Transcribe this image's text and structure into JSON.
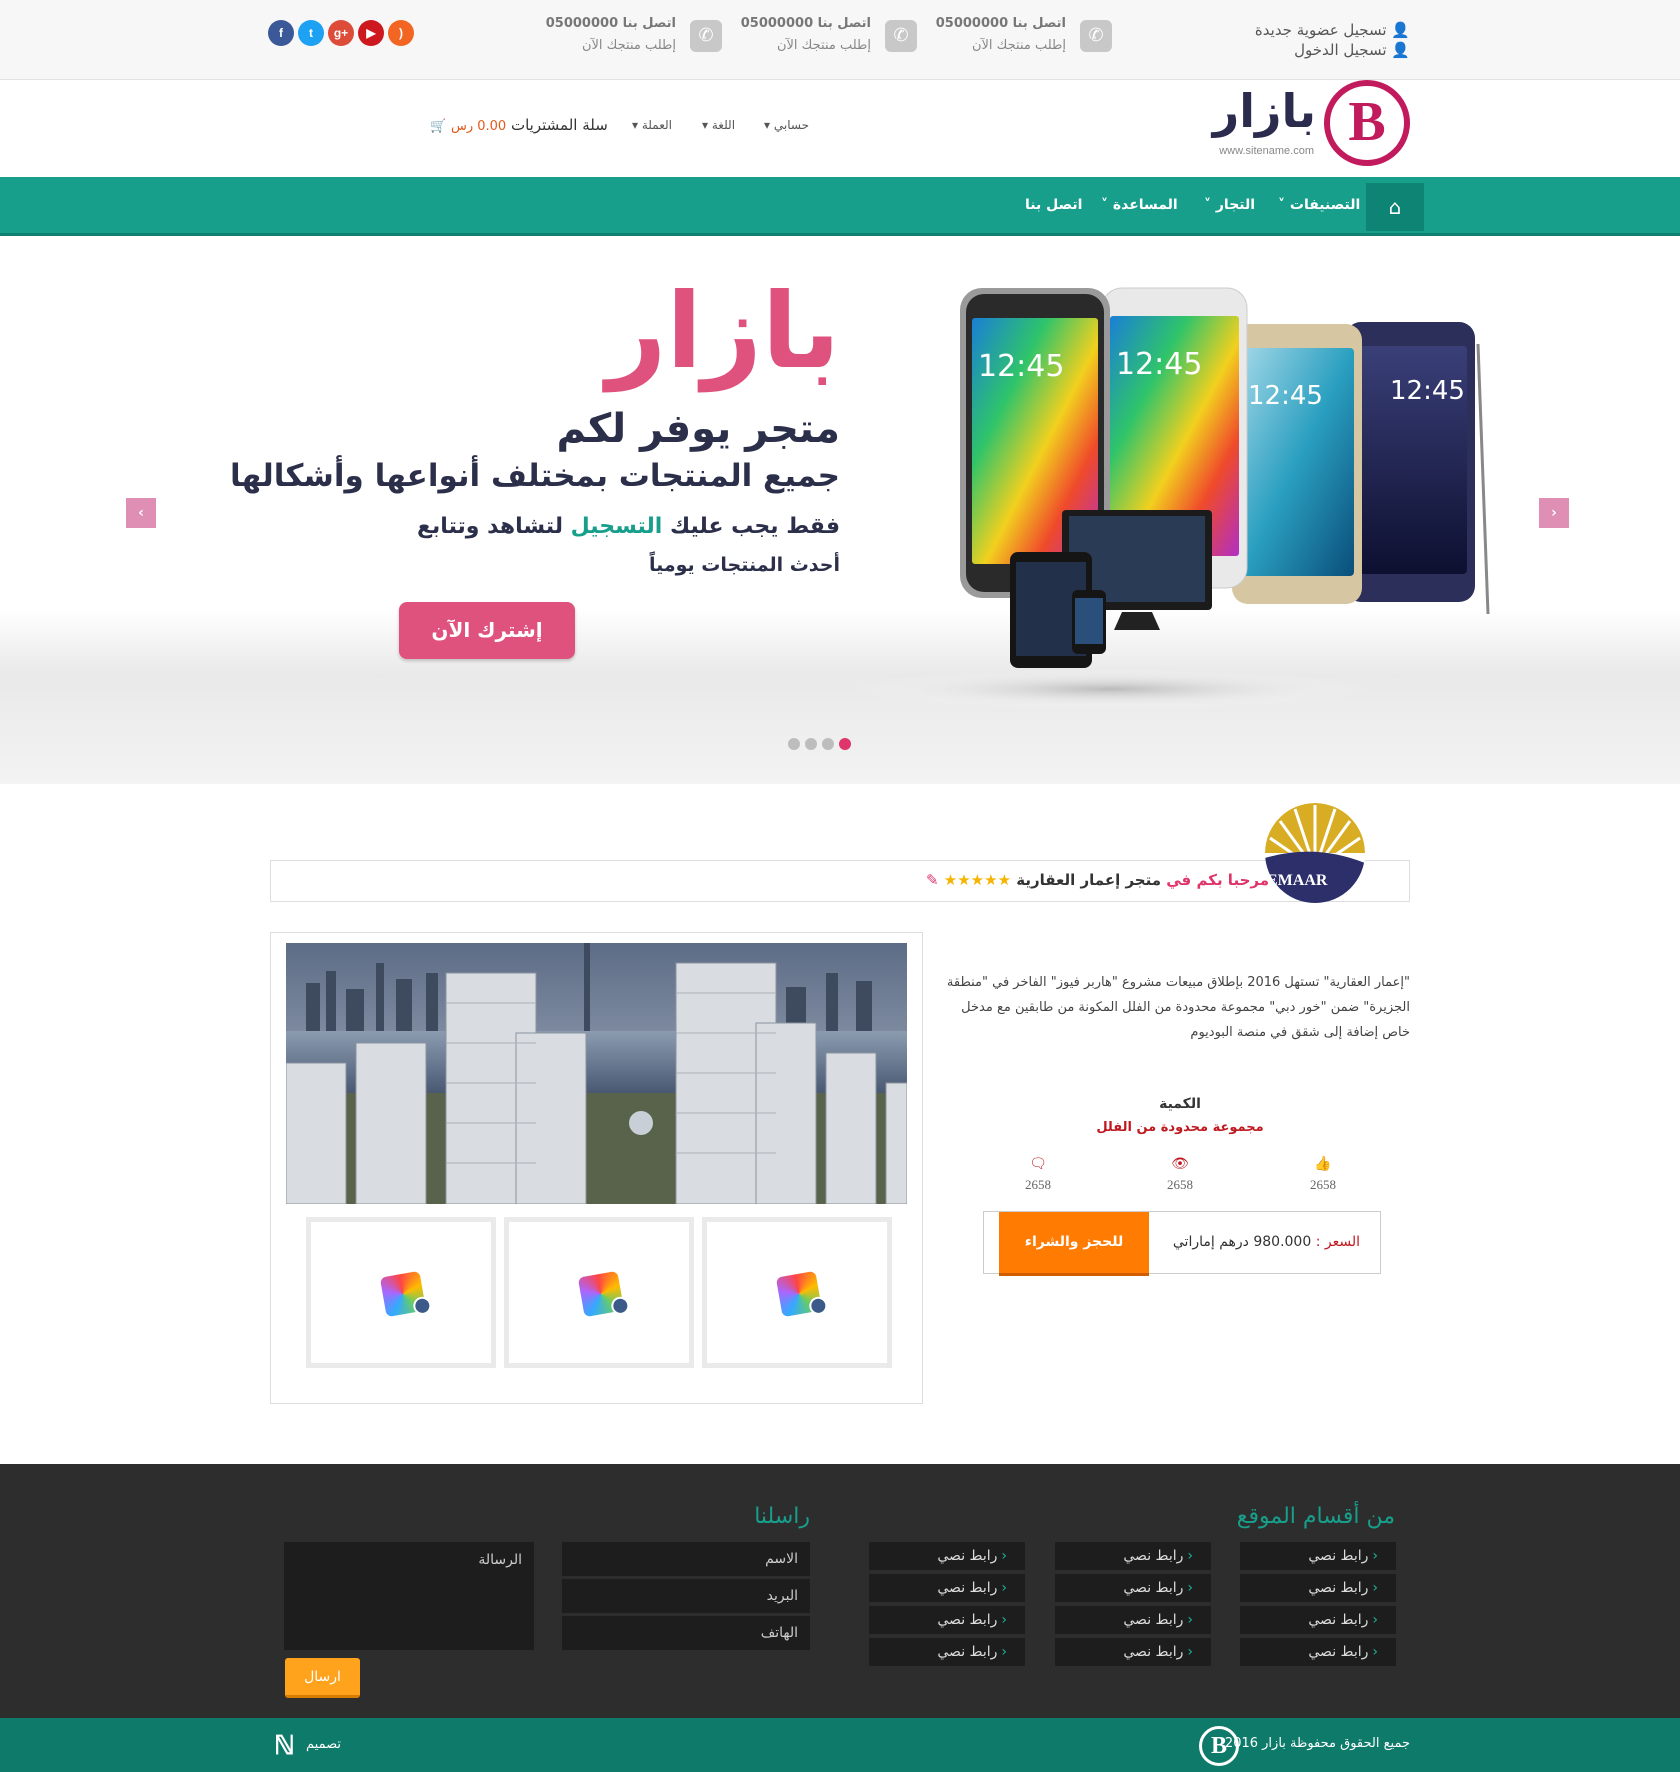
{
  "topbar": {
    "register": "تسجيل عضوية جديدة",
    "login": "تسجيل الدخول",
    "contacts": [
      {
        "title": "اتصل بنا 05000000",
        "subtitle": "إطلب منتجك الآن"
      },
      {
        "title": "اتصل بنا 05000000",
        "subtitle": "إطلب منتجك الآن"
      },
      {
        "title": "اتصل بنا 05000000",
        "subtitle": "إطلب منتجك الآن"
      }
    ],
    "social": [
      {
        "name": "facebook-icon",
        "glyph": "f",
        "color": "#3b5998"
      },
      {
        "name": "twitter-icon",
        "glyph": "t",
        "color": "#1da1f2"
      },
      {
        "name": "google-plus-icon",
        "glyph": "g+",
        "color": "#dd4b39"
      },
      {
        "name": "youtube-icon",
        "glyph": "▶",
        "color": "#cc181e"
      },
      {
        "name": "rss-icon",
        "glyph": ")",
        "color": "#f26522"
      }
    ]
  },
  "header": {
    "logo_letter": "B",
    "brand": "بازار",
    "url": "www.sitename.com",
    "account": "حسابي",
    "language": "اللغة",
    "currency": "العملة",
    "cart_label": "سلة المشتريات",
    "cart_amount": "0.00 رس"
  },
  "nav": {
    "home_icon": "home-icon",
    "items": [
      "التصنيفات",
      "التجار",
      "المساعدة",
      "اتصل بنا"
    ]
  },
  "slider": {
    "brand": "بازار",
    "line1": "متجر يوفر لكم",
    "line2": "جميع المنتجات بمختلف أنواعها وأشكالها",
    "line3_before": "فقط يجب عليك",
    "line3_highlight": "التسجيل",
    "line3_after": "لتشاهد وتتابع",
    "line4": "أحدث المنتجات يومياً",
    "cta": "إشترك الآن",
    "phone_time": "12:45",
    "dots": 4,
    "active_dot": 3
  },
  "store": {
    "welcome": "مرحبا بكم في",
    "name": "متجر إعمار العقارية",
    "stars": "★★★★★",
    "logo_text": "EMAAR",
    "description": "\"إعمار العقارية\" تستهل 2016 بإطلاق مبيعات مشروع \"هاربر فيوز\" الفاخر في \"منطقة الجزيرة\" ضمن \"خور دبي\" مجموعة محدودة من الفلل المكونة من طابقين مع مدخل خاص إضافة إلى شقق في منصة البوديوم",
    "qty_label": "الكمية",
    "qty_value": "مجموعة محدودة من الفلل",
    "stats": {
      "comments": "2658",
      "views": "2658",
      "likes": "2658"
    },
    "price_label": "السعر :",
    "price_value": "980.000 درهم إماراتي",
    "buy": "للحجز والشراء"
  },
  "footer": {
    "sections_title": "من أقسام الموقع",
    "contact_title": "راسلنا",
    "link_text": "رابط نصي",
    "name_ph": "الاسم",
    "email_ph": "البريد",
    "phone_ph": "الهاتف",
    "message_ph": "الرسالة",
    "send": "ارسال"
  },
  "bottom": {
    "copyright": "جميع الحقوق محفوظة بازار 2016",
    "design": "تصميم"
  }
}
